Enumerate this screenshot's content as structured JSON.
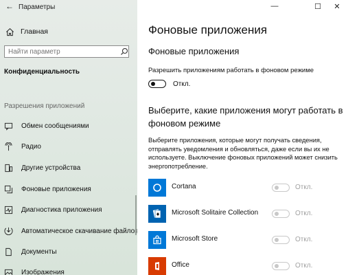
{
  "window": {
    "title": "Параметры",
    "controls": {
      "minimize": "—",
      "maximize": "☐",
      "close": "✕"
    }
  },
  "sidebar": {
    "back": "←",
    "home_label": "Главная",
    "search_placeholder": "Найти параметр",
    "section_title": "Конфиденциальность",
    "group_label": "Разрешения приложений",
    "items": [
      {
        "label": "Обмен сообщениями",
        "icon": "chat-icon"
      },
      {
        "label": "Радио",
        "icon": "radio-icon"
      },
      {
        "label": "Другие устройства",
        "icon": "devices-icon"
      },
      {
        "label": "Фоновые приложения",
        "icon": "background-apps-icon"
      },
      {
        "label": "Диагностика приложения",
        "icon": "diagnostics-icon"
      },
      {
        "label": "Автоматическое скачивание файлов",
        "icon": "download-icon"
      },
      {
        "label": "Документы",
        "icon": "document-icon"
      },
      {
        "label": "Изображения",
        "icon": "image-icon"
      }
    ]
  },
  "main": {
    "page_title": "Фоновые приложения",
    "section_title": "Фоновые приложения",
    "allow_label": "Разрешить приложениям работать в фоновом режиме",
    "allow_toggle": {
      "state": "Откл.",
      "on": false
    },
    "choose_title": "Выберите, какие приложения могут работать в фоновом режиме",
    "choose_desc": "Выберите приложения, которые могут получать сведения, отправлять уведомления и обновляться, даже если вы их не используете. Выключение фоновых приложений может снизить энергопотребление.",
    "apps": [
      {
        "name": "Cortana",
        "state": "Откл.",
        "color": "#0078d7",
        "icon": "cortana-icon"
      },
      {
        "name": "Microsoft Solitaire Collection",
        "state": "Откл.",
        "color": "#0063b1",
        "icon": "solitaire-icon"
      },
      {
        "name": "Microsoft Store",
        "state": "Откл.",
        "color": "#0078d7",
        "icon": "store-icon"
      },
      {
        "name": "Office",
        "state": "Откл.",
        "color": "#d83b01",
        "icon": "office-icon"
      }
    ]
  },
  "colors": {
    "accent": "#0078d7",
    "toggle_disabled": "#c8c8c8",
    "sidebar_bg": "#e3eae4"
  }
}
